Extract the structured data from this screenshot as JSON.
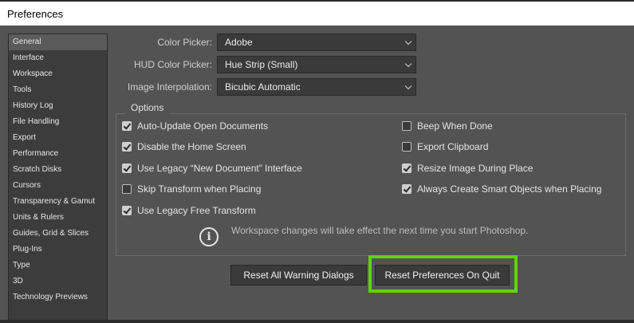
{
  "window": {
    "title": "Preferences"
  },
  "sidebar": {
    "items": [
      {
        "label": "General",
        "selected": true
      },
      {
        "label": "Interface"
      },
      {
        "label": "Workspace"
      },
      {
        "label": "Tools"
      },
      {
        "label": "History Log"
      },
      {
        "label": "File Handling"
      },
      {
        "label": "Export"
      },
      {
        "label": "Performance"
      },
      {
        "label": "Scratch Disks"
      },
      {
        "label": "Cursors"
      },
      {
        "label": "Transparency & Gamut"
      },
      {
        "label": "Units & Rulers"
      },
      {
        "label": "Guides, Grid & Slices"
      },
      {
        "label": "Plug-Ins"
      },
      {
        "label": "Type"
      },
      {
        "label": "3D"
      },
      {
        "label": "Technology Previews"
      }
    ]
  },
  "general": {
    "color_picker": {
      "label": "Color Picker:",
      "value": "Adobe"
    },
    "hud_color_picker": {
      "label": "HUD Color Picker:",
      "value": "Hue Strip (Small)"
    },
    "image_interpolation": {
      "label": "Image Interpolation:",
      "value": "Bicubic Automatic"
    }
  },
  "options": {
    "label": "Options",
    "left": [
      {
        "label": "Auto-Update Open Documents",
        "checked": true
      },
      {
        "label": "Disable the Home Screen",
        "checked": true
      },
      {
        "label": "Use Legacy “New Document” Interface",
        "checked": true
      },
      {
        "label": "Skip Transform when Placing",
        "checked": false
      },
      {
        "label": "Use Legacy Free Transform",
        "checked": true
      }
    ],
    "right": [
      {
        "label": "Beep When Done",
        "checked": false
      },
      {
        "label": "Export Clipboard",
        "checked": false
      },
      {
        "label": "Resize Image During Place",
        "checked": true
      },
      {
        "label": "Always Create Smart Objects when Placing",
        "checked": true
      }
    ],
    "info": "Workspace changes will take effect the next time you start Photoshop."
  },
  "buttons": {
    "reset_warnings": "Reset All Warning Dialogs",
    "reset_prefs": "Reset Preferences On Quit"
  },
  "colors": {
    "highlight": "#5fd400",
    "panel_bg": "#535353",
    "sidebar_bg": "#3c3c3c"
  }
}
